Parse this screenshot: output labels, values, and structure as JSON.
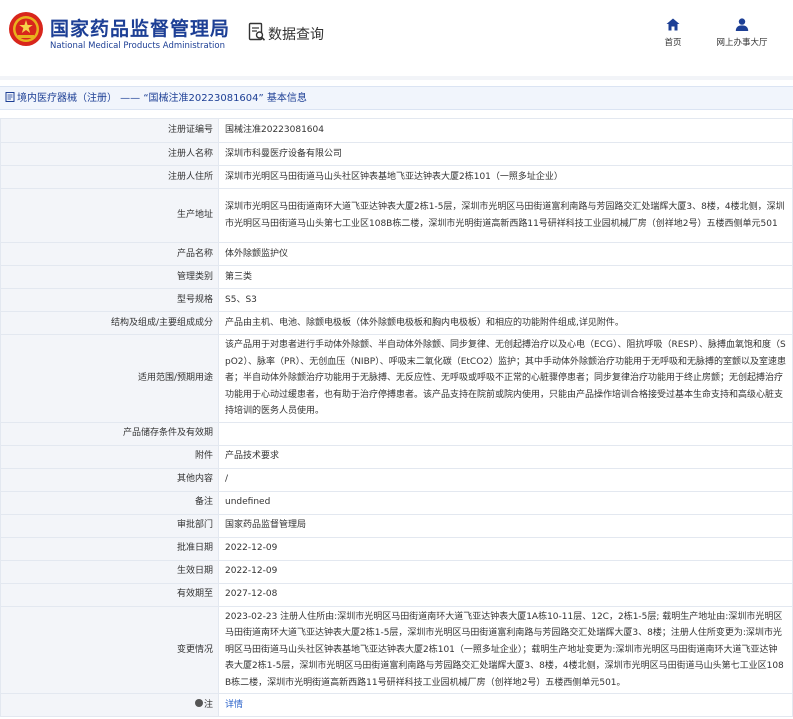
{
  "header": {
    "brand_cn": "国家药品监督管理局",
    "brand_en": "National Medical Products Administration",
    "section_title": "数据查询",
    "nav": [
      {
        "label": "首页",
        "icon": "home-icon"
      },
      {
        "label": "网上办事大厅",
        "icon": "user-icon"
      }
    ],
    "brand_color": "#1d3f95"
  },
  "breadcrumb": "境内医疗器械（注册） —— “国械注准20223081604” 基本信息",
  "rows": [
    {
      "label": "注册证编号",
      "value": "国械注准20223081604"
    },
    {
      "label": "注册人名称",
      "value": "深圳市科曼医疗设备有限公司"
    },
    {
      "label": "注册人住所",
      "value": "深圳市光明区马田街道马山头社区钟表基地飞亚达钟表大厦2栋101（一照多址企业）"
    },
    {
      "label": "生产地址",
      "value": "深圳市光明区马田街道南环大道飞亚达钟表大厦2栋1-5层，深圳市光明区马田街道富利南路与芳园路交汇处瑞辉大厦3、8楼，4楼北侧，深圳市光明区马田街道马山头第七工业区108B栋二楼，深圳市光明街道高新西路11号研祥科技工业园机械厂房（创祥地2号）五楼西侧单元501"
    },
    {
      "label": "产品名称",
      "value": "体外除颤监护仪"
    },
    {
      "label": "管理类别",
      "value": "第三类"
    },
    {
      "label": "型号规格",
      "value": "S5、S3"
    },
    {
      "label": "结构及组成/主要组成成分",
      "value": "产品由主机、电池、除颤电极板（体外除颤电极板和胸内电极板）和相应的功能附件组成,详见附件。"
    },
    {
      "label": "适用范围/预期用途",
      "value": "该产品用于对患者进行手动体外除颤、半自动体外除颤、同步复律、无创起搏治疗以及心电（ECG）、阻抗呼吸（RESP）、脉搏血氧饱和度（SpO2）、脉率（PR）、无创血压（NIBP）、呼吸末二氧化碳（EtCO2）监护；其中手动体外除颤治疗功能用于无呼吸和无脉搏的室颤以及室速患者；半自动体外除颤治疗功能用于无脉搏、无反应性、无呼吸或呼吸不正常的心脏骤停患者；同步复律治疗功能用于终止房颤；无创起搏治疗功能用于心动过缓患者，也有助于治疗停搏患者。该产品支持在院前或院内使用，只能由产品操作培训合格接受过基本生命支持和高级心脏支持培训的医务人员使用。"
    },
    {
      "label": "产品储存条件及有效期",
      "value": ""
    },
    {
      "label": "附件",
      "value": "产品技术要求"
    },
    {
      "label": "其他内容",
      "value": "/"
    },
    {
      "label": "备注",
      "value": "undefined"
    },
    {
      "label": "审批部门",
      "value": "国家药品监督管理局"
    },
    {
      "label": "批准日期",
      "value": "2022-12-09"
    },
    {
      "label": "生效日期",
      "value": "2022-12-09"
    },
    {
      "label": "有效期至",
      "value": "2027-12-08"
    },
    {
      "label": "变更情况",
      "value": "2023-02-23 注册人住所由:深圳市光明区马田街道南环大道飞亚达钟表大厦1A栋10-11层、12C，2栋1-5层; 载明生产地址由:深圳市光明区马田街道南环大道飞亚达钟表大厦2栋1-5层，深圳市光明区马田街道富利南路与芳园路交汇处瑞辉大厦3、8楼；注册人住所变更为:深圳市光明区马田街道马山头社区钟表基地飞亚达钟表大厦2栋101（一照多址企业）；载明生产地址变更为:深圳市光明区马田街道南环大道飞亚达钟表大厦2栋1-5层，深圳市光明区马田街道富利南路与芳园路交汇处瑞辉大厦3、8楼，4楼北侧，深圳市光明区马田街道马山头第七工业区108B栋二楼，深圳市光明街道高新西路11号研祥科技工业园机械厂房（创祥地2号）五楼西侧单元501。"
    },
    {
      "label": "注",
      "value": "详情"
    }
  ]
}
